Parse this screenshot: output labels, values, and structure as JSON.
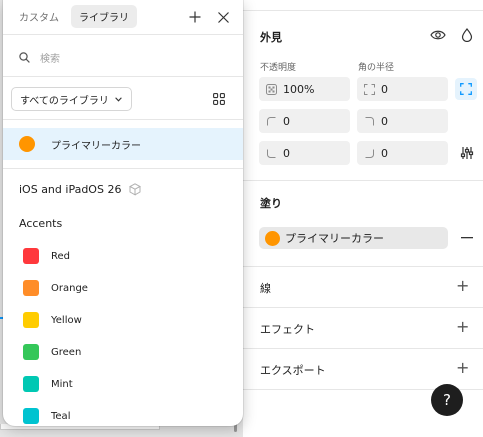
{
  "popover": {
    "tabs": [
      {
        "label": "カスタム",
        "active": false
      },
      {
        "label": "ライブラリ",
        "active": true
      }
    ],
    "search_placeholder": "検索",
    "library_select": "すべてのライブラリ",
    "selected_style": {
      "name": "プライマリーカラー",
      "color": "#ff9500"
    },
    "library_name": "iOS and iPadOS 26",
    "group_name": "Accents",
    "colors": [
      {
        "name": "Red",
        "color": "#ff383c"
      },
      {
        "name": "Orange",
        "color": "#ff8d28"
      },
      {
        "name": "Yellow",
        "color": "#ffcc00"
      },
      {
        "name": "Green",
        "color": "#34c759"
      },
      {
        "name": "Mint",
        "color": "#00c8b3"
      },
      {
        "name": "Teal",
        "color": "#00c3d0"
      }
    ]
  },
  "panel": {
    "appearance": {
      "title": "外見",
      "opacity_label": "不透明度",
      "opacity_value": "100%",
      "radius_label": "角の半径",
      "radius_value": "0",
      "corner_tl": "0",
      "corner_tr": "0",
      "corner_bl": "0",
      "corner_br": "0"
    },
    "fill": {
      "title": "塗り",
      "style_name": "プライマリーカラー",
      "style_color": "#ff9500"
    },
    "stroke_label": "線",
    "effects_label": "エフェクト",
    "export_label": "エクスポート"
  },
  "help_label": "?",
  "accent_color": "#0d99ff"
}
